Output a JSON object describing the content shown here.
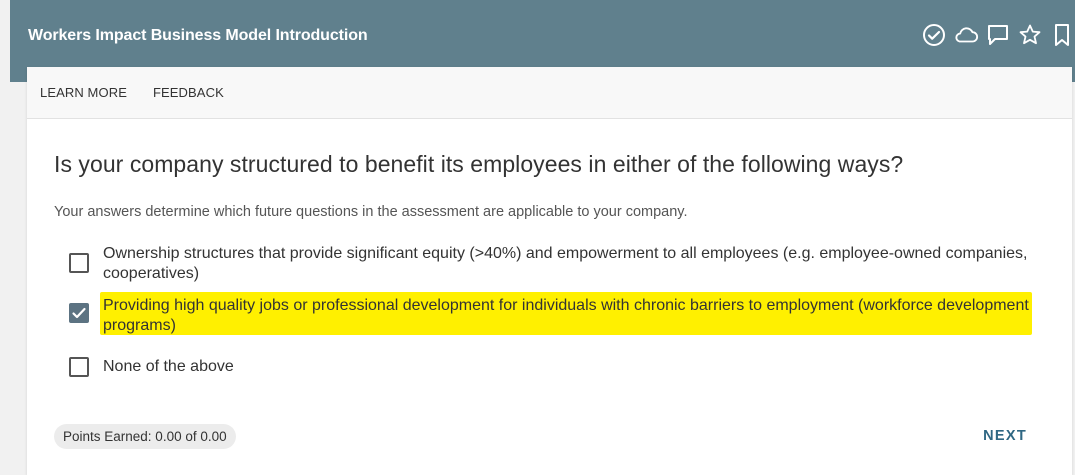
{
  "header": {
    "title": "Workers Impact Business Model Introduction",
    "icons": [
      "check-circle-icon",
      "cloud-icon",
      "comment-icon",
      "star-icon",
      "bookmark-icon"
    ],
    "background": "#60808d"
  },
  "toolbar": {
    "learn_more": "LEARN MORE",
    "feedback": "FEEDBACK"
  },
  "question": {
    "title": "Is your company structured to benefit its employees in either of the following ways?",
    "subtitle": "Your answers determine which future questions in the assessment are applicable to your company.",
    "options": [
      {
        "label": "Ownership structures that provide significant equity (>40%) and empowerment to all employees (e.g. employee-owned companies, cooperatives)",
        "checked": false
      },
      {
        "label": "Providing high quality jobs or professional development for individuals with chronic barriers to employment (workforce development programs)",
        "checked": true
      },
      {
        "label": "None of the above",
        "checked": false
      }
    ]
  },
  "footer": {
    "points": "Points Earned: 0.00 of 0.00",
    "next": "NEXT"
  },
  "colors": {
    "highlight": "#fff000",
    "accent": "#2f6783",
    "checkbox_checked": "#5c7382"
  }
}
